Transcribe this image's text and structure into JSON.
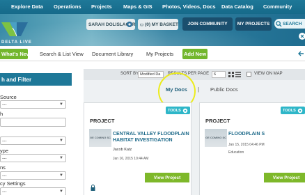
{
  "top_nav": {
    "items": [
      "Explore Data",
      "Operations",
      "Projects",
      "Maps & GIS",
      "Photos, Videos, Docs",
      "Data Catalog",
      "Community"
    ]
  },
  "header": {
    "logo_text": "DELTA LIVE",
    "user_label": "SARAH DOLISLAGER",
    "basket_label": "(0) MY BASKET",
    "join_label": "JOIN COMMUNITY",
    "my_projects_label": "MY PROJECTS",
    "search_label": "SEARCH"
  },
  "sub_nav": {
    "tabs": [
      "What's New",
      "Search & List View",
      "Document Library",
      "My Projects",
      "Add New"
    ]
  },
  "sidebar": {
    "header": "h and Filter",
    "fields": [
      {
        "label": "Source",
        "value": "---"
      },
      {
        "label": "h",
        "value": ""
      },
      {
        "label": "",
        "value": "---"
      },
      {
        "label": "ype",
        "value": "---"
      },
      {
        "label": "ns",
        "value": "---"
      },
      {
        "label": "cy Settings",
        "value": "---"
      }
    ]
  },
  "sort_bar": {
    "sort_by_label": "SORT BY",
    "sort_value": "Modified Da",
    "results_label": "RESULTS PER PAGE",
    "results_value": "6",
    "view_map_label": "VIEW ON MAP"
  },
  "doc_toggle": {
    "my_docs": "My Docs",
    "separator": "|",
    "public_docs": "Public Docs"
  },
  "cards": [
    {
      "type": "PROJECT",
      "tools_label": "TOOLS",
      "thumb_text": "GE COMING SC",
      "title": "CENTRAL VALLEY FLOODPLAIN HABITAT INVESTIGATION",
      "author": "Jacob Katz",
      "date": "Jan 16, 2015 10:44 AM",
      "button": "View Project"
    },
    {
      "type": "PROJECT",
      "tools_label": "TOOLS",
      "thumb_text": "GE COMING SC",
      "title": "FLOODPLAIN S",
      "author": "",
      "date": "Jan 15, 2015 04:46 PM",
      "category": "Education",
      "button": "View Project"
    }
  ],
  "colors": {
    "nav_blue": "#1e7898",
    "accent_green": "#72b62c",
    "tools_teal": "#2eb6c8",
    "highlight_yellow": "#ecec1c"
  }
}
